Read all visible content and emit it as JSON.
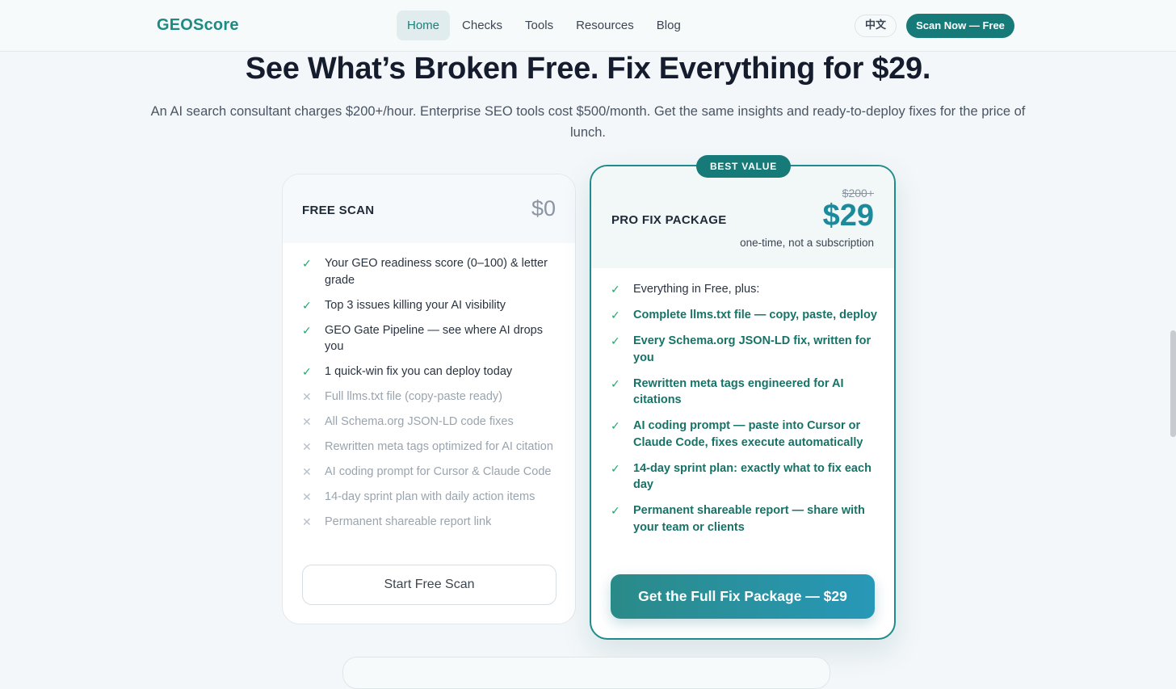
{
  "nav": {
    "logo": "GEOScore",
    "links": [
      "Home",
      "Checks",
      "Tools",
      "Resources",
      "Blog"
    ],
    "lang": "中文",
    "cta": "Scan Now — Free"
  },
  "hero": {
    "title": "See What’s Broken Free. Fix Everything for $29.",
    "subtitle": "An AI search consultant charges $200+/hour. Enterprise SEO tools cost $500/month. Get the same insights and ready-to-deploy fixes for the price of lunch."
  },
  "free": {
    "name": "FREE SCAN",
    "price": "$0",
    "features": [
      {
        "text": "Your GEO readiness score (0–100) & letter grade",
        "included": true
      },
      {
        "text": "Top 3 issues killing your AI visibility",
        "included": true
      },
      {
        "text": "GEO Gate Pipeline — see where AI drops you",
        "included": true
      },
      {
        "text": "1 quick-win fix you can deploy today",
        "included": true
      },
      {
        "text": "Full llms.txt file (copy-paste ready)",
        "included": false
      },
      {
        "text": "All Schema.org JSON-LD code fixes",
        "included": false
      },
      {
        "text": "Rewritten meta tags optimized for AI citation",
        "included": false
      },
      {
        "text": "AI coding prompt for Cursor & Claude Code",
        "included": false
      },
      {
        "text": "14-day sprint plan with daily action items",
        "included": false
      },
      {
        "text": "Permanent shareable report link",
        "included": false
      }
    ],
    "button": "Start Free Scan"
  },
  "pro": {
    "badge": "BEST VALUE",
    "name": "PRO FIX PACKAGE",
    "old_price": "$200+",
    "price": "$29",
    "note": "one-time, not a subscription",
    "features": [
      {
        "text": "Everything in Free, plus:",
        "highlight": false
      },
      {
        "text": "Complete llms.txt file — copy, paste, deploy",
        "highlight": true
      },
      {
        "text": "Every Schema.org JSON-LD fix, written for you",
        "highlight": true
      },
      {
        "text": "Rewritten meta tags engineered for AI citations",
        "highlight": true
      },
      {
        "text": "AI coding prompt — paste into Cursor or Claude Code, fixes execute automatically",
        "highlight": true
      },
      {
        "text": "14-day sprint plan: exactly what to fix each day",
        "highlight": true
      },
      {
        "text": "Permanent shareable report — share with your team or clients",
        "highlight": true
      }
    ],
    "button": "Get the Full Fix Package — $29"
  },
  "icons": {
    "check": "check-icon",
    "cross": "cross-icon"
  },
  "colors": {
    "accent": "#167a79",
    "check": "#1ea86a",
    "pro_text": "#177367"
  }
}
